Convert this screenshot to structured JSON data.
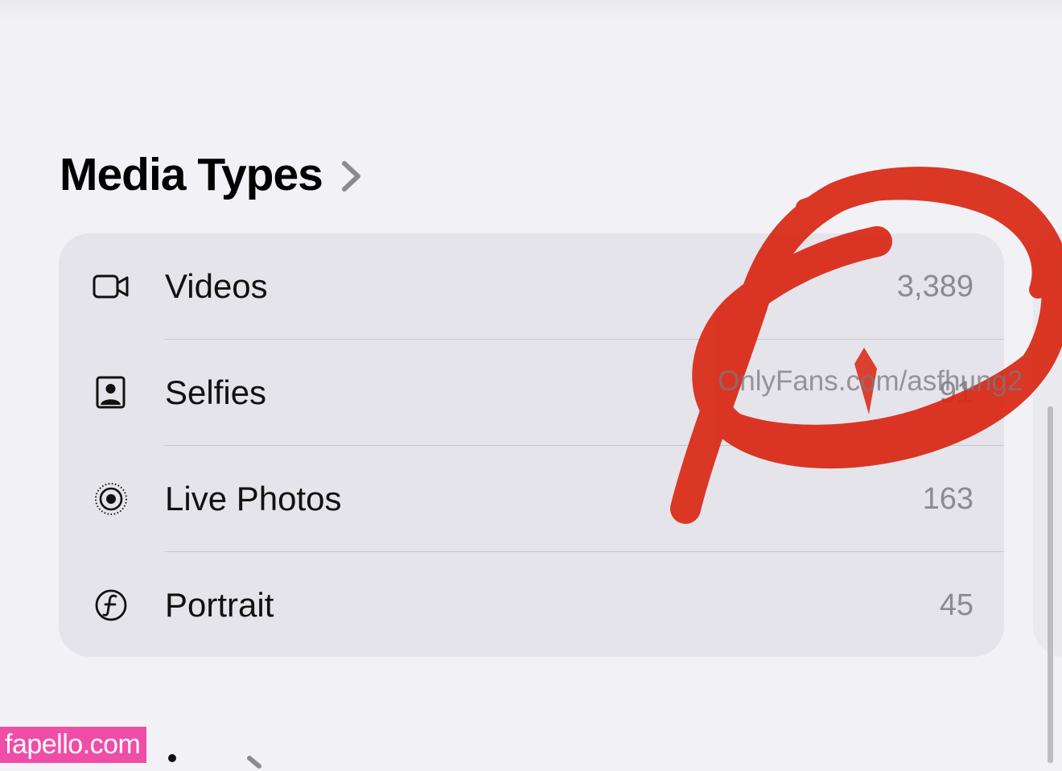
{
  "section": {
    "title": "Media Types"
  },
  "media_types": [
    {
      "label": "Videos",
      "count": "3,389",
      "icon": "video-camera-icon"
    },
    {
      "label": "Selfies",
      "count": "91",
      "icon": "selfie-portrait-icon"
    },
    {
      "label": "Live Photos",
      "count": "163",
      "icon": "live-photo-icon"
    },
    {
      "label": "Portrait",
      "count": "45",
      "icon": "portrait-f-aperture-icon"
    }
  ],
  "overlay": {
    "watermark_text": "OnlyFans.com/asfhung2",
    "badge_text": "fapello.com",
    "scribble_color": "#d9230f"
  },
  "colors": {
    "background": "#f2f2f6",
    "card": "#e4e4ea",
    "secondary_text": "#8a8a8f",
    "badge": "#ef4da7"
  }
}
